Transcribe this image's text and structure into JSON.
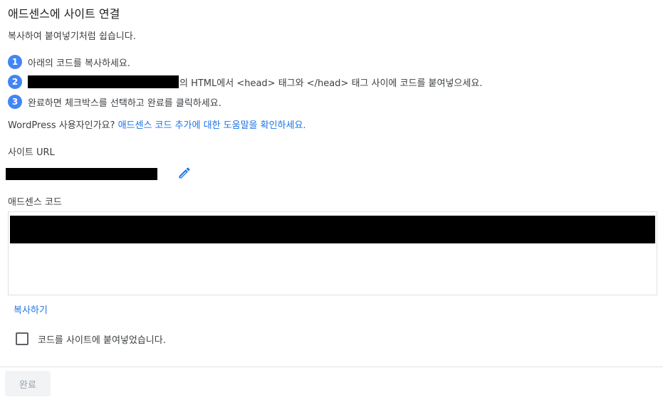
{
  "header": {
    "title": "애드센스에 사이트 연결",
    "subtitle": "복사하여 붙여넣기처럼 쉽습니다."
  },
  "steps": [
    {
      "number": "1",
      "text": "아래의 코드를 복사하세요."
    },
    {
      "number": "2",
      "text": "의 HTML에서 <head> 태그와 </head> 태그 사이에 코드를 붙여넣으세요."
    },
    {
      "number": "3",
      "text": "완료하면 체크박스를 선택하고 완료를 클릭하세요."
    }
  ],
  "wordpress": {
    "prefix": "WordPress 사용자인가요?",
    "link": "애드센스 코드 추가에 대한 도움말을 확인하세요."
  },
  "site_url": {
    "label": "사이트 URL",
    "edit_icon": "pencil-icon"
  },
  "adsense_code": {
    "label": "애드센스 코드",
    "copy_label": "복사하기"
  },
  "confirm": {
    "label": "코드를 사이트에 붙여넣었습니다.",
    "checked": false
  },
  "footer": {
    "done_label": "완료",
    "done_enabled": false
  },
  "colors": {
    "accent": "#1a73e8",
    "step_badge": "#4285f4",
    "disabled_button_bg": "#f1f3f4",
    "disabled_button_text": "#9aa0a6"
  }
}
